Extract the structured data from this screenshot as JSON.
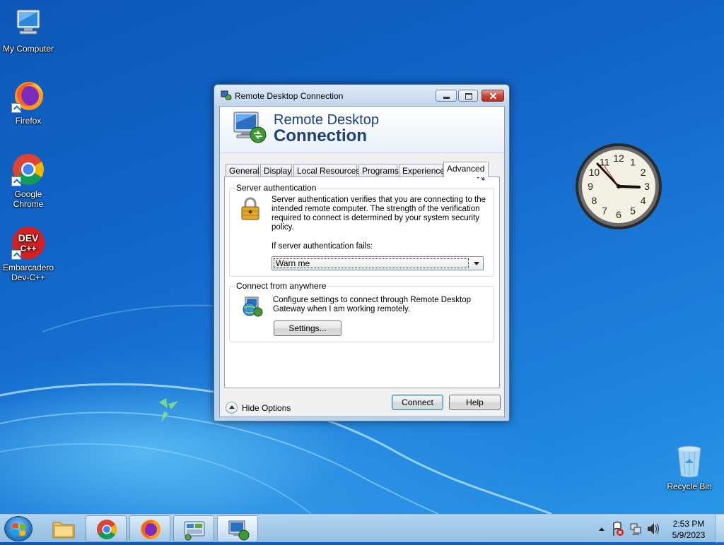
{
  "desktop": {
    "icons": [
      {
        "label": "My Computer"
      },
      {
        "label": "Firefox"
      },
      {
        "label": "Google Chrome"
      },
      {
        "label": "Embarcadero Dev-C++"
      },
      {
        "label": "Recycle Bin"
      }
    ],
    "devcpp_logo_text": "DEV C++"
  },
  "window": {
    "title": "Remote Desktop Connection",
    "banner_line1": "Remote Desktop",
    "banner_line2": "Connection",
    "tabs": [
      {
        "label": "General"
      },
      {
        "label": "Display"
      },
      {
        "label": "Local Resources"
      },
      {
        "label": "Programs"
      },
      {
        "label": "Experience"
      },
      {
        "label": "Advanced",
        "active": true
      }
    ],
    "server_auth": {
      "group_label": "Server authentication",
      "description": "Server authentication verifies that you are connecting to the intended remote computer. The strength of the verification required to connect is determined by your system security policy.",
      "fail_label": "If server authentication fails:",
      "fail_value": "Warn me"
    },
    "connect_anywhere": {
      "group_label": "Connect from anywhere",
      "description": "Configure settings to connect through Remote Desktop Gateway when I am working remotely.",
      "settings_button": "Settings..."
    },
    "hide_options": "Hide Options",
    "connect_button": "Connect",
    "help_button": "Help"
  },
  "clock": {
    "hour_numbers": [
      "12",
      "1",
      "2",
      "3",
      "4",
      "5",
      "6",
      "7",
      "8",
      "9",
      "10",
      "11"
    ]
  },
  "taskbar": {
    "time": "2:53 PM",
    "date": "5/9/2023"
  },
  "colors": {
    "accent": "#1d3f7a",
    "close": "#c7483a",
    "desktop": "#1266c9"
  }
}
